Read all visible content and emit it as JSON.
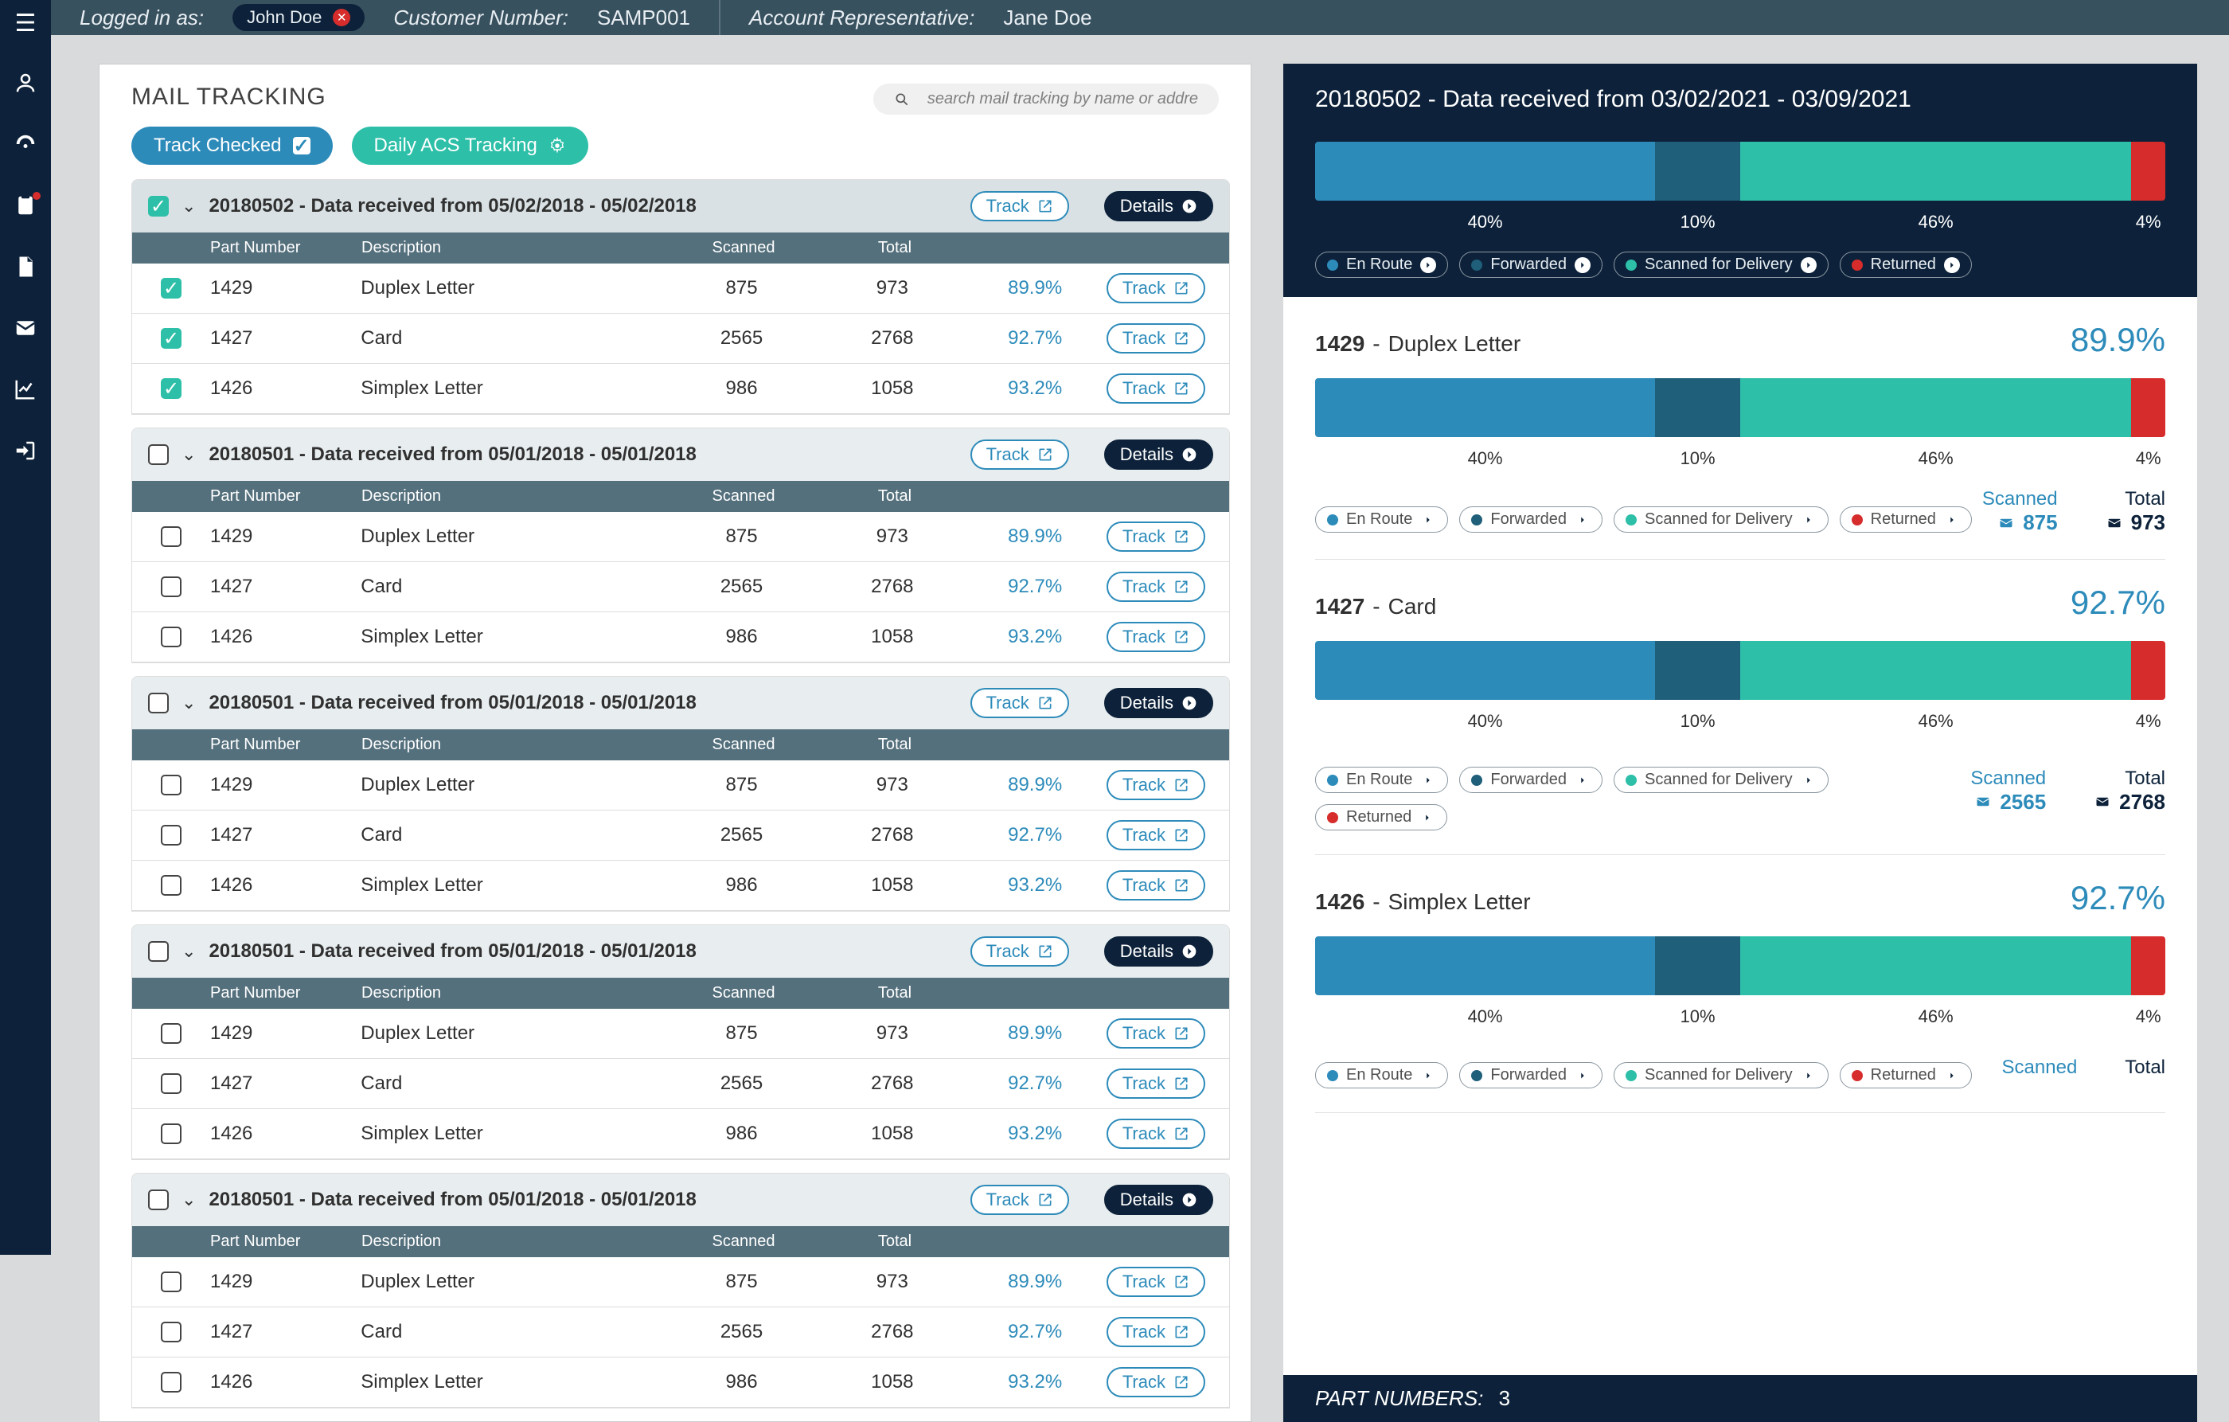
{
  "topbar": {
    "logged_in_label": "Logged in as:",
    "user_name": "John Doe",
    "customer_label": "Customer Number:",
    "customer_value": "SAMP001",
    "rep_label": "Account Representative:",
    "rep_value": "Jane Doe"
  },
  "page": {
    "title": "MAIL TRACKING",
    "search_placeholder": "search mail tracking by name or addre",
    "track_checked_label": "Track Checked",
    "daily_acs_label": "Daily ACS Tracking"
  },
  "columns": {
    "part": "Part Number",
    "desc": "Description",
    "scan": "Scanned",
    "total": "Total"
  },
  "buttons": {
    "track": "Track",
    "details": "Details"
  },
  "groups": [
    {
      "id": "20180502",
      "title": "20180502 - Data received from 05/02/2018 - 05/02/2018",
      "checked": true,
      "rows": [
        {
          "pn": "1429",
          "desc": "Duplex Letter",
          "scan": "875",
          "total": "973",
          "pct": "89.9%",
          "checked": true
        },
        {
          "pn": "1427",
          "desc": "Card",
          "scan": "2565",
          "total": "2768",
          "pct": "92.7%",
          "checked": true
        },
        {
          "pn": "1426",
          "desc": "Simplex Letter",
          "scan": "986",
          "total": "1058",
          "pct": "93.2%",
          "checked": true
        }
      ]
    },
    {
      "id": "20180501a",
      "title": "20180501 - Data received from 05/01/2018 - 05/01/2018",
      "checked": false,
      "rows": [
        {
          "pn": "1429",
          "desc": "Duplex Letter",
          "scan": "875",
          "total": "973",
          "pct": "89.9%",
          "checked": false
        },
        {
          "pn": "1427",
          "desc": "Card",
          "scan": "2565",
          "total": "2768",
          "pct": "92.7%",
          "checked": false
        },
        {
          "pn": "1426",
          "desc": "Simplex Letter",
          "scan": "986",
          "total": "1058",
          "pct": "93.2%",
          "checked": false
        }
      ]
    },
    {
      "id": "20180501b",
      "title": "20180501 - Data received from 05/01/2018 - 05/01/2018",
      "checked": false,
      "rows": [
        {
          "pn": "1429",
          "desc": "Duplex Letter",
          "scan": "875",
          "total": "973",
          "pct": "89.9%",
          "checked": false
        },
        {
          "pn": "1427",
          "desc": "Card",
          "scan": "2565",
          "total": "2768",
          "pct": "92.7%",
          "checked": false
        },
        {
          "pn": "1426",
          "desc": "Simplex Letter",
          "scan": "986",
          "total": "1058",
          "pct": "93.2%",
          "checked": false
        }
      ]
    },
    {
      "id": "20180501c",
      "title": "20180501 - Data received from 05/01/2018 - 05/01/2018",
      "checked": false,
      "rows": [
        {
          "pn": "1429",
          "desc": "Duplex Letter",
          "scan": "875",
          "total": "973",
          "pct": "89.9%",
          "checked": false
        },
        {
          "pn": "1427",
          "desc": "Card",
          "scan": "2565",
          "total": "2768",
          "pct": "92.7%",
          "checked": false
        },
        {
          "pn": "1426",
          "desc": "Simplex Letter",
          "scan": "986",
          "total": "1058",
          "pct": "93.2%",
          "checked": false
        }
      ]
    },
    {
      "id": "20180501d",
      "title": "20180501 - Data received from 05/01/2018 - 05/01/2018",
      "checked": false,
      "rows": [
        {
          "pn": "1429",
          "desc": "Duplex Letter",
          "scan": "875",
          "total": "973",
          "pct": "89.9%",
          "checked": false
        },
        {
          "pn": "1427",
          "desc": "Card",
          "scan": "2565",
          "total": "2768",
          "pct": "92.7%",
          "checked": false
        },
        {
          "pn": "1426",
          "desc": "Simplex Letter",
          "scan": "986",
          "total": "1058",
          "pct": "93.2%",
          "checked": false
        }
      ]
    }
  ],
  "chart_data": {
    "type": "bar",
    "title": "20180502 - Data received from 03/02/2021 - 03/09/2021",
    "categories": [
      "En Route",
      "Forwarded",
      "Scanned for Delivery",
      "Returned"
    ],
    "values": [
      40,
      10,
      46,
      4
    ],
    "colors": {
      "route": "#2d8bba",
      "fwd": "#1f5f7a",
      "scan": "#2dbfa8",
      "ret": "#d62c2c"
    }
  },
  "legend": {
    "route": "En Route",
    "fwd": "Forwarded",
    "scan": "Scanned for Delivery",
    "ret": "Returned"
  },
  "detail_cards": [
    {
      "pn": "1429",
      "name": "Duplex Letter",
      "pct": "89.9%",
      "segs": [
        40,
        10,
        46,
        4
      ],
      "scanned_label": "Scanned",
      "scanned": "875",
      "total_label": "Total",
      "total": "973"
    },
    {
      "pn": "1427",
      "name": "Card",
      "pct": "92.7%",
      "segs": [
        40,
        10,
        46,
        4
      ],
      "scanned_label": "Scanned",
      "scanned": "2565",
      "total_label": "Total",
      "total": "2768"
    },
    {
      "pn": "1426",
      "name": "Simplex Letter",
      "pct": "92.7%",
      "segs": [
        40,
        10,
        46,
        4
      ],
      "scanned_label": "Scanned",
      "scanned": "",
      "total_label": "Total",
      "total": ""
    }
  ],
  "footer": {
    "label": "PART NUMBERS:",
    "count": "3"
  }
}
